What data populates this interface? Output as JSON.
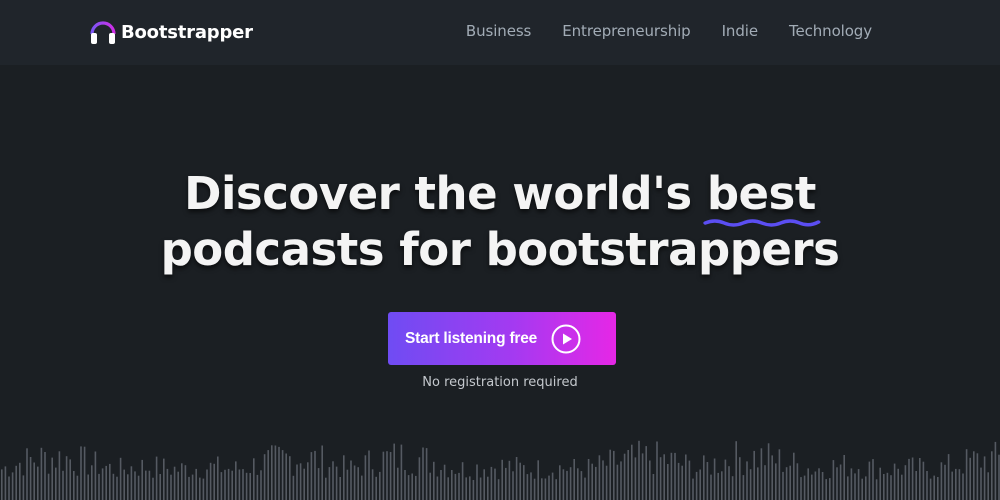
{
  "brand": {
    "name": "Bootstrapper",
    "logo_icon": "headphones-icon",
    "accent_color": "#a43af1"
  },
  "nav": {
    "items": [
      {
        "label": "Business"
      },
      {
        "label": "Entrepreneurship"
      },
      {
        "label": "Indie"
      },
      {
        "label": "Technology"
      }
    ]
  },
  "hero": {
    "title_line1_before": "Discover the world's ",
    "title_highlight": "best",
    "title_line2": "podcasts for bootstrappers",
    "underline_color": "#5b4ef2"
  },
  "cta": {
    "label": "Start listening free",
    "icon": "play-circle-icon",
    "note": "No registration required",
    "gradient": [
      "#6f4cf3",
      "#e627e6"
    ]
  },
  "decor": {
    "waveform_icon": "audio-waveform"
  }
}
